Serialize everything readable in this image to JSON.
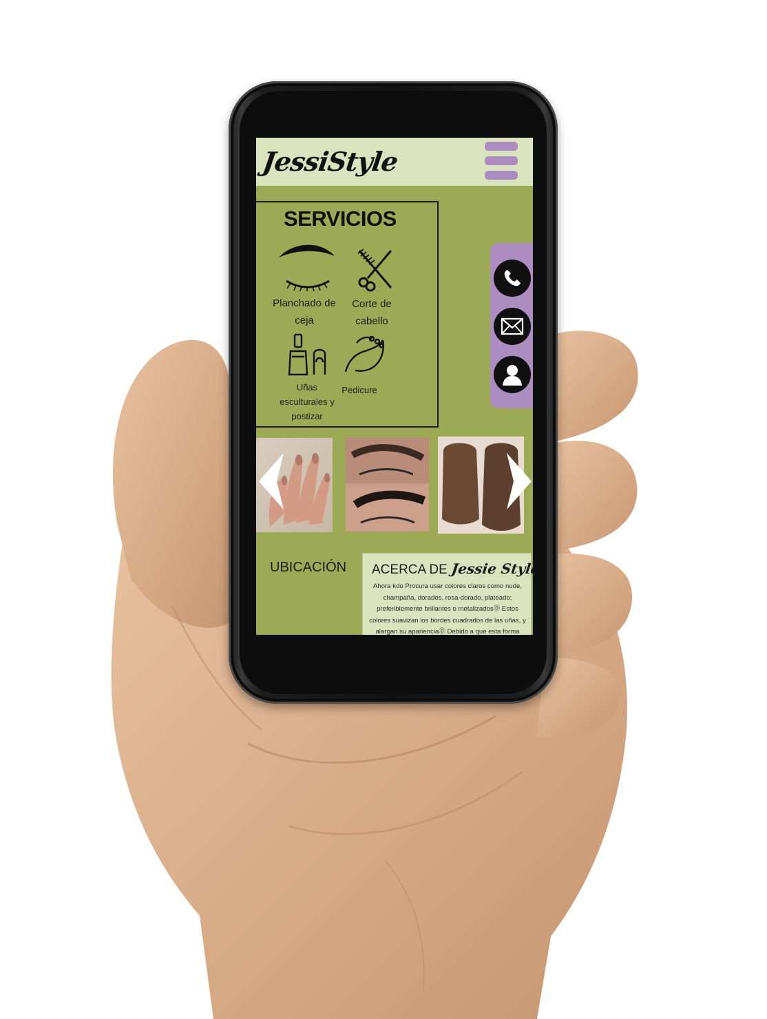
{
  "app": {
    "logo": "JessiStyle"
  },
  "header": {
    "menu_icon": "hamburger-menu-icon"
  },
  "services": {
    "title": "SERVICIOS",
    "items": [
      {
        "label_1": "Planchado de",
        "label_2": "ceja",
        "icon": "eyebrow-icon"
      },
      {
        "label_1": "Corte de",
        "label_2": "cabello",
        "icon": "scissors-comb-icon"
      },
      {
        "label_1": "Uñas",
        "label_2": "esculturales y",
        "label_3": "postizar",
        "icon": "nail-polish-icon"
      },
      {
        "label_1": "Pedicure",
        "icon": "foot-icon"
      }
    ]
  },
  "contact": {
    "icons": [
      "phone-icon",
      "mail-icon",
      "user-icon"
    ]
  },
  "carousel": {
    "images": [
      "nails-photo",
      "eyebrows-before-after-photo",
      "hair-before-after-photo"
    ],
    "prev_icon": "chevron-left-icon",
    "next_icon": "chevron-right-icon"
  },
  "location": {
    "title": "UBICACIÓN"
  },
  "about": {
    "title": "ACERCA DE",
    "brand": "Jessie Style",
    "text": "Ahora kdo Procura usar colores claros como nude, champaña, dorados, rosa-dorado, plateado; preferiblemente brillantes o metalizadosⒹ Estos colores suavizan los bordes cuadrados de las uñas, y alargan su aparienciaⒹ Debido a que esta forma"
  },
  "colors": {
    "page_bg": "#9daa55",
    "header_bg": "#d9e4bf",
    "accent_purple": "#ad8dc1",
    "text_dark": "#111111"
  }
}
